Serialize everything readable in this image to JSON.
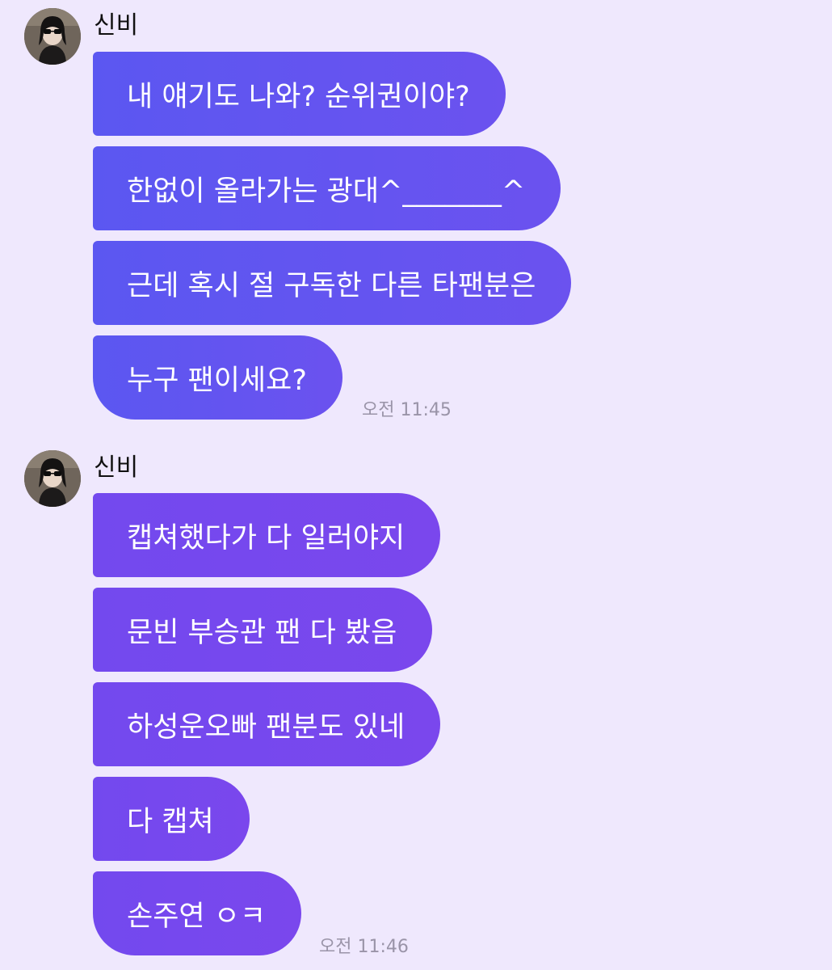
{
  "messages": [
    {
      "sender": "신비",
      "bubbles": [
        "내 얘기도 나와? 순위권이야?",
        "한없이 올라가는 광대^_______^",
        "근데 혹시 절 구독한 다른 타팬분은",
        "누구 팬이세요?"
      ],
      "time": "오전 11:45"
    },
    {
      "sender": "신비",
      "bubbles": [
        "캡쳐했다가 다 일러야지",
        "문빈 부승관 팬 다 봤음",
        "하성운오빠 팬분도 있네",
        "다 캡쳐",
        "손주연 ㅇㅋ"
      ],
      "time": "오전 11:46"
    }
  ],
  "colors": {
    "background": "#efe8fd",
    "bubble_group1": "#5f56f0",
    "bubble_group2": "#7649ee",
    "timestamp": "#9a94a8"
  },
  "icons": {
    "avatar": "profile-photo"
  }
}
